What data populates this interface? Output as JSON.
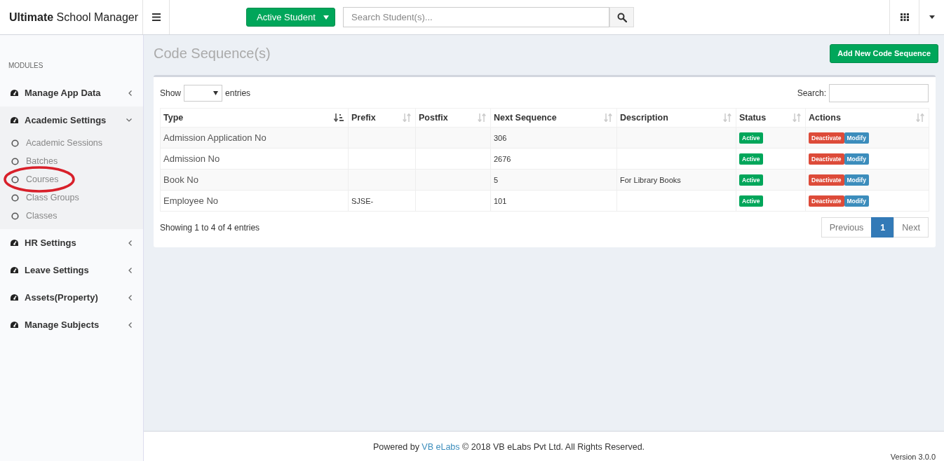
{
  "app": {
    "title": "**Ultimate** School Manager"
  },
  "topbar": {
    "student_button": "Active Student",
    "search": {
      "placeholder": "Search Student(s)..."
    }
  },
  "sidebar": {
    "heading": "MODULES",
    "items": [
      {
        "label": "Manage App Data",
        "expanded": false
      },
      {
        "label": "Academic Settings",
        "expanded": true,
        "children": [
          {
            "label": "Academic Sessions",
            "circled": false
          },
          {
            "label": "Batches",
            "circled": false
          },
          {
            "label": "Courses",
            "circled": true
          },
          {
            "label": "Class Groups",
            "circled": false
          },
          {
            "label": "Classes",
            "circled": false
          }
        ]
      },
      {
        "label": "HR Settings",
        "expanded": false
      },
      {
        "label": "Leave Settings",
        "expanded": false
      },
      {
        "label": "Assets(Property)",
        "expanded": false
      },
      {
        "label": "Manage Subjects",
        "expanded": false
      }
    ]
  },
  "page": {
    "title": "Code Sequence(s)",
    "add_button": "Add New Code Sequence"
  },
  "table": {
    "show_label": "Show",
    "entries_label": "entries",
    "search_label": "Search:",
    "columns": [
      {
        "label": "Type",
        "sorted": true
      },
      {
        "label": "Prefix",
        "sorted": false
      },
      {
        "label": "Postfix",
        "sorted": false
      },
      {
        "label": "Next Sequence",
        "sorted": false
      },
      {
        "label": "Description",
        "sorted": false
      },
      {
        "label": "Status",
        "sorted": false
      },
      {
        "label": "Actions",
        "sorted": false
      }
    ],
    "rows": [
      {
        "type": "Admission Application No",
        "prefix": "",
        "postfix": "",
        "next": "306",
        "description": "",
        "status": {
          "label": "Active",
          "kind": "active"
        },
        "actions": [
          {
            "label": "Deactivate",
            "kind": "danger"
          },
          {
            "label": "Modify",
            "kind": "primary"
          }
        ]
      },
      {
        "type": "Admission No",
        "prefix": "",
        "postfix": "",
        "next": "2676",
        "description": "",
        "status": {
          "label": "Active",
          "kind": "active"
        },
        "actions": [
          {
            "label": "Deactivate",
            "kind": "danger"
          },
          {
            "label": "Modify",
            "kind": "primary"
          }
        ]
      },
      {
        "type": "Book No",
        "prefix": "",
        "postfix": "",
        "next": "5",
        "description": "For Library Books",
        "status": {
          "label": "Active",
          "kind": "active"
        },
        "actions": [
          {
            "label": "Deactivate",
            "kind": "danger"
          },
          {
            "label": "Modify",
            "kind": "primary"
          }
        ]
      },
      {
        "type": "Employee No",
        "prefix": "SJSE-",
        "postfix": "",
        "next": "101",
        "description": "",
        "status": {
          "label": "Active",
          "kind": "active"
        },
        "actions": [
          {
            "label": "Deactivate",
            "kind": "danger"
          },
          {
            "label": "Modify",
            "kind": "primary"
          }
        ]
      }
    ],
    "info": "Showing 1 to 4 of 4 entries",
    "pagination": [
      {
        "label": "Previous",
        "selected": false
      },
      {
        "label": "1",
        "selected": true
      },
      {
        "label": "Next",
        "selected": false
      }
    ]
  },
  "footer": {
    "powered": "Powered by",
    "link": "VB eLabs",
    "copyright": "© 2018 VB eLabs Pvt Ltd. All Rights Reserved.",
    "version": "Version 3.0.0"
  }
}
